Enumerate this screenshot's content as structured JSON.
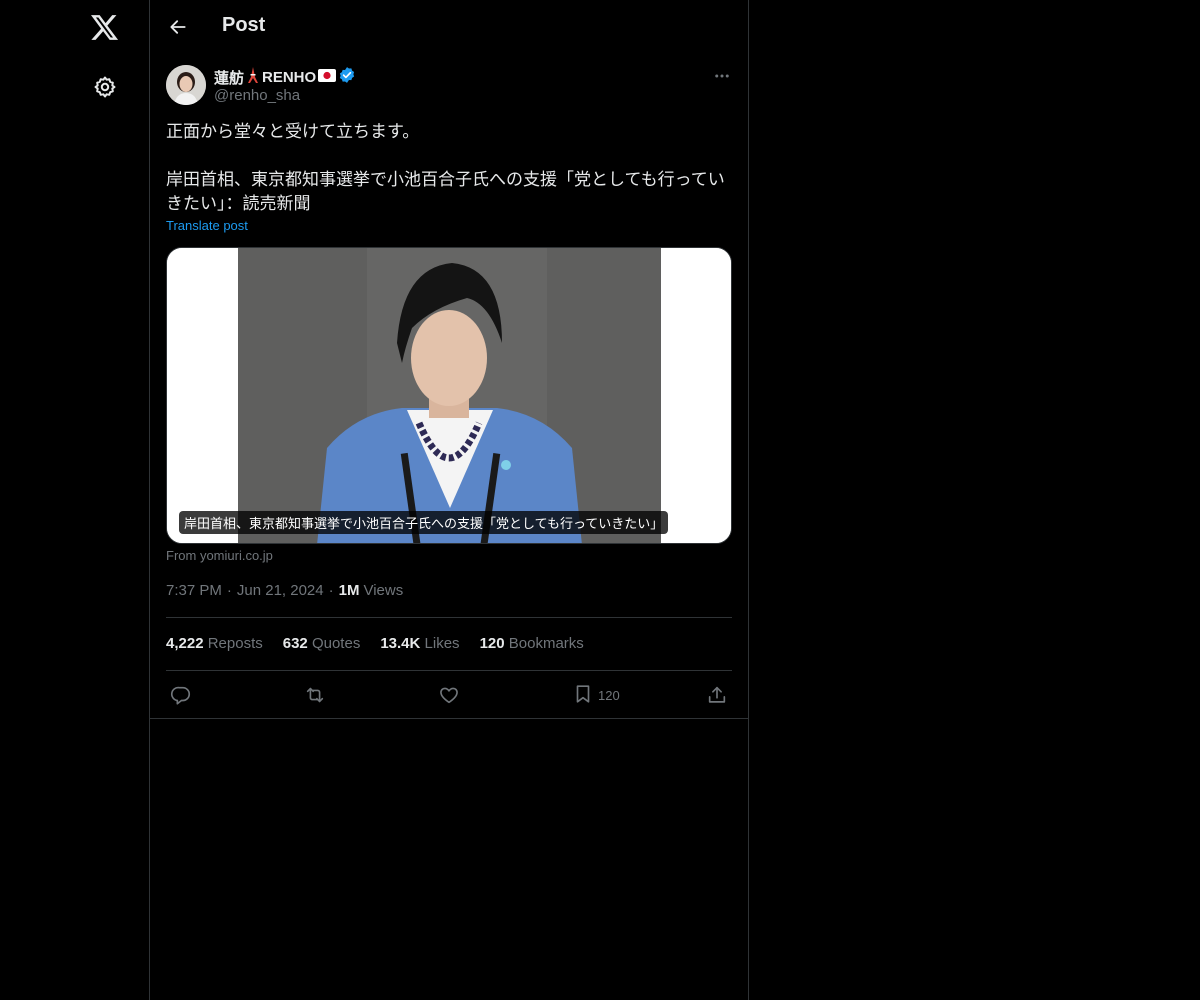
{
  "header": {
    "title": "Post"
  },
  "author": {
    "display_name_part1": "蓮舫",
    "display_name_part2": "RENHO",
    "handle": "@renho_sha",
    "verified": true
  },
  "post": {
    "text": "正面から堂々と受けて立ちます。\n\n岸田首相、東京都知事選挙で小池百合子氏への支援「党としても行っていきたい」：読売新聞",
    "translate_label": "Translate post"
  },
  "card": {
    "caption": "岸田首相、東京都知事選挙で小池百合子氏への支援「党としても行っていきたい」",
    "from": "From yomiuri.co.jp"
  },
  "meta": {
    "time": "7:37 PM",
    "date": "Jun 21, 2024",
    "views_count": "1M",
    "views_label": "Views"
  },
  "stats": {
    "reposts_count": "4,222",
    "reposts_label": "Reposts",
    "quotes_count": "632",
    "quotes_label": "Quotes",
    "likes_count": "13.4K",
    "likes_label": "Likes",
    "bookmarks_count": "120",
    "bookmarks_label": "Bookmarks"
  },
  "actions": {
    "bookmark_count": "120"
  },
  "icons": {
    "nav": [
      "x-logo-icon",
      "settings-gear-icon"
    ],
    "header": [
      "back-arrow-icon"
    ],
    "post": [
      "verified-badge-icon",
      "more-icon"
    ],
    "actions": [
      "reply-icon",
      "repost-icon",
      "like-icon",
      "bookmark-icon",
      "share-icon"
    ]
  },
  "colors": {
    "background": "#000000",
    "text": "#e7e9ea",
    "secondary_text": "#71767b",
    "accent": "#1d9bf0",
    "border": "#2f3336"
  }
}
